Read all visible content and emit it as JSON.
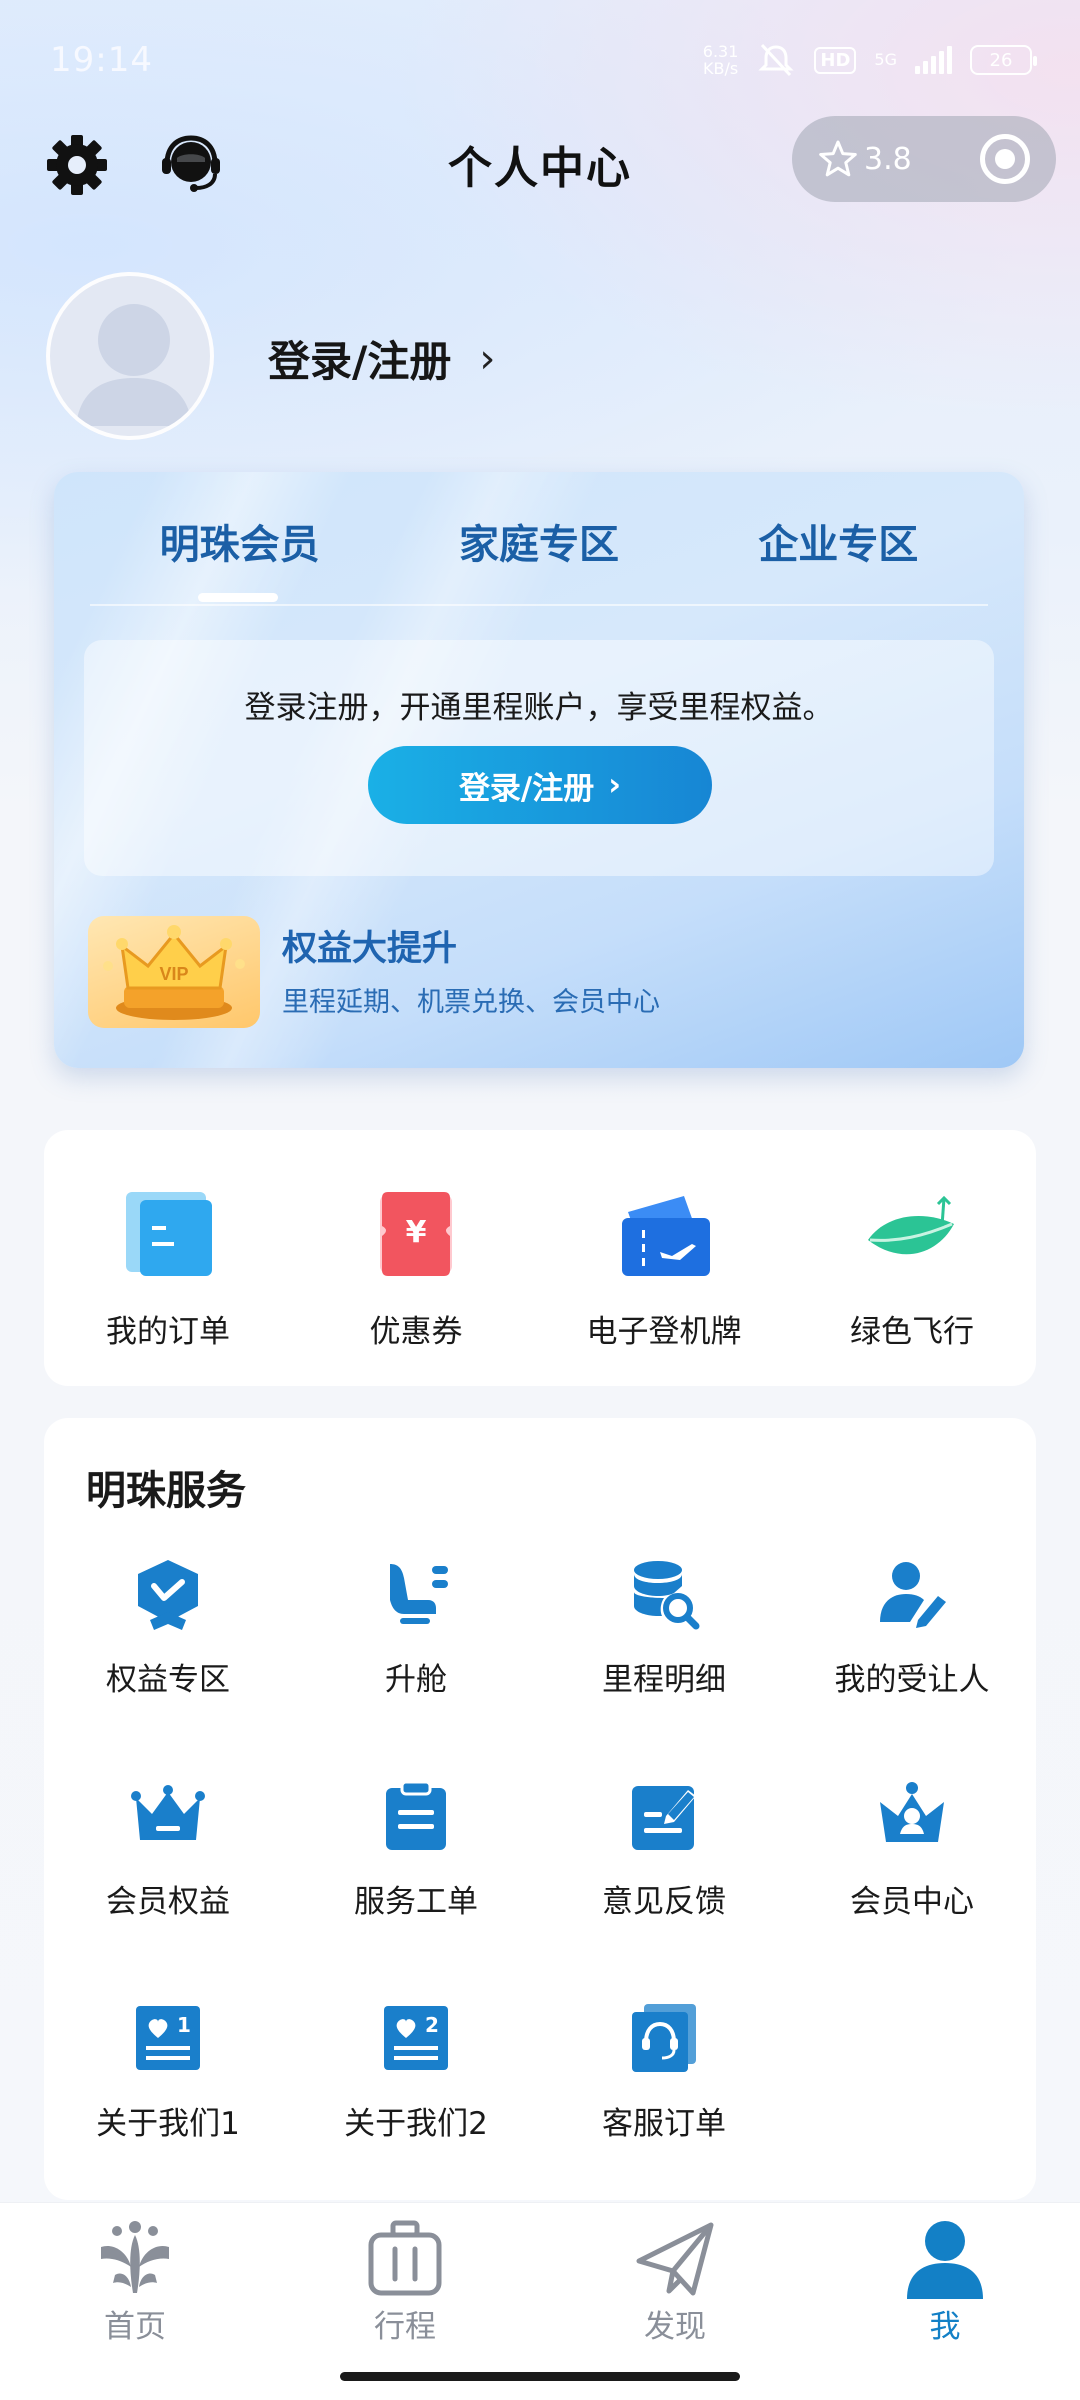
{
  "status_bar": {
    "time": "19:14",
    "net_speed": "6.31",
    "net_unit": "KB/s",
    "network_type": "5G",
    "hd_label": "HD",
    "battery": "26"
  },
  "header": {
    "title": "个人中心",
    "rating": "3.8",
    "settings_icon": "gear-icon",
    "service_icon": "headset-icon"
  },
  "profile": {
    "login_label": "登录/注册",
    "chevron": "›"
  },
  "member_card": {
    "tabs": [
      {
        "label": "明珠会员",
        "active": true
      },
      {
        "label": "家庭专区",
        "active": false
      },
      {
        "label": "企业专区",
        "active": false
      }
    ],
    "promo_text": "登录注册，开通里程账户，享受里程权益。",
    "login_button": "登录/注册",
    "login_button_chevron": "›",
    "perk_title": "权益大提升",
    "perk_subtitle": "里程延期、机票兑换、会员中心",
    "vip_badge_text": "VIP"
  },
  "quick_actions": [
    {
      "label": "我的订单",
      "icon": "order-icon"
    },
    {
      "label": "优惠券",
      "icon": "coupon-icon"
    },
    {
      "label": "电子登机牌",
      "icon": "boarding-pass-icon"
    },
    {
      "label": "绿色飞行",
      "icon": "leaf-icon"
    }
  ],
  "services": {
    "title": "明珠服务",
    "items": [
      {
        "label": "权益专区",
        "icon": "badge-icon"
      },
      {
        "label": "升舱",
        "icon": "seat-icon"
      },
      {
        "label": "里程明细",
        "icon": "database-search-icon"
      },
      {
        "label": "我的受让人",
        "icon": "user-edit-icon"
      },
      {
        "label": "会员权益",
        "icon": "crown-icon"
      },
      {
        "label": "服务工单",
        "icon": "clipboard-icon"
      },
      {
        "label": "意见反馈",
        "icon": "feedback-icon"
      },
      {
        "label": "会员中心",
        "icon": "member-crown-icon"
      },
      {
        "label": "关于我们1",
        "icon": "about-card-1-icon",
        "badge": "1"
      },
      {
        "label": "关于我们2",
        "icon": "about-card-2-icon",
        "badge": "2"
      },
      {
        "label": "客服订单",
        "icon": "support-order-icon"
      }
    ]
  },
  "bottom_nav": [
    {
      "label": "首页",
      "icon": "home-logo-icon",
      "active": false
    },
    {
      "label": "行程",
      "icon": "luggage-icon",
      "active": false
    },
    {
      "label": "发现",
      "icon": "paper-plane-icon",
      "active": false
    },
    {
      "label": "我",
      "icon": "user-icon",
      "active": true
    }
  ],
  "colors": {
    "brand_blue": "#1380c6",
    "tab_text": "#1b5fa6",
    "button_gradient_start": "#1ab0e6",
    "button_gradient_end": "#1786d4"
  }
}
